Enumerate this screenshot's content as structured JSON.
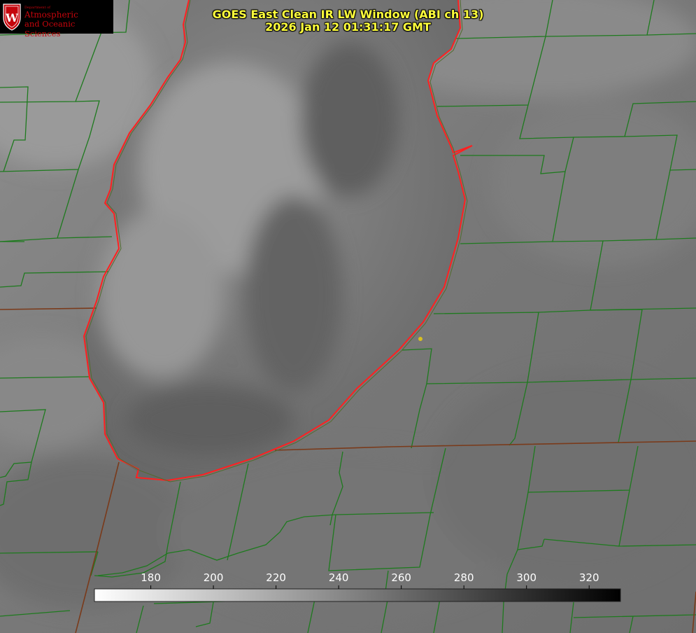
{
  "title": {
    "line1": "GOES East Clean IR LW Window (ABI ch 13)",
    "line2": "2026 Jan 12 01:31:17 GMT"
  },
  "logo": {
    "dept": "Department of",
    "line1": "Atmospheric",
    "line2": "and Oceanic Sciences",
    "crest_letter": "W",
    "crest_color": "#c5050c"
  },
  "colorbar": {
    "min": 162,
    "max": 330,
    "ticks": [
      180,
      200,
      220,
      240,
      260,
      280,
      300,
      320
    ],
    "tick_labels": [
      "180",
      "200",
      "220",
      "240",
      "260",
      "280",
      "300",
      "320"
    ],
    "start_color": "#ffffff",
    "end_color": "#000000"
  },
  "colors": {
    "title": "#ffff3c",
    "county_lines": "#1e7a1e",
    "lake_outline": "#ff2020",
    "state_lines": "#7a3a1a",
    "marker": "#d8c020"
  }
}
